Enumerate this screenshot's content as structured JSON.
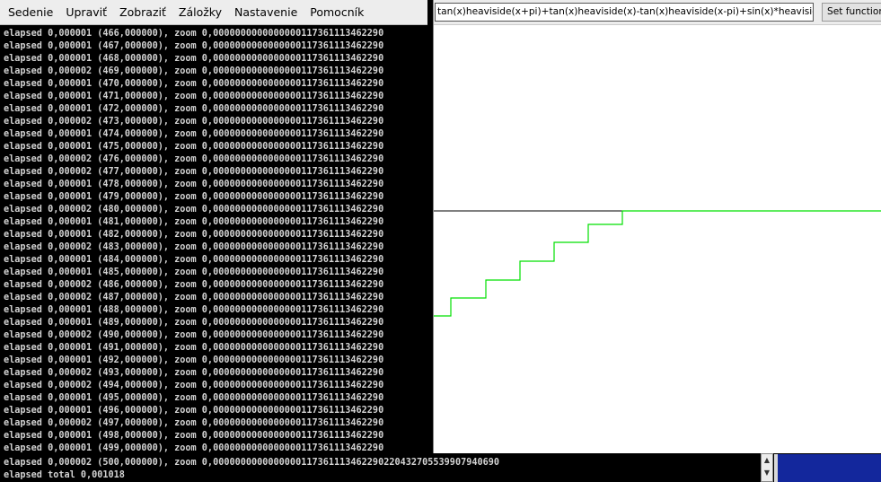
{
  "terminal": {
    "menu": [
      "Sedenie",
      "Upraviť",
      "Zobraziť",
      "Záložky",
      "Nastavenie",
      "Pomocník"
    ],
    "lines": [
      "elapsed 0,000001 (466,000000), zoom 0,0000000000000000117361113462290",
      "elapsed 0,000001 (467,000000), zoom 0,0000000000000000117361113462290",
      "elapsed 0,000001 (468,000000), zoom 0,0000000000000000117361113462290",
      "elapsed 0,000002 (469,000000), zoom 0,0000000000000000117361113462290",
      "elapsed 0,000001 (470,000000), zoom 0,0000000000000000117361113462290",
      "elapsed 0,000001 (471,000000), zoom 0,0000000000000000117361113462290",
      "elapsed 0,000001 (472,000000), zoom 0,0000000000000000117361113462290",
      "elapsed 0,000002 (473,000000), zoom 0,0000000000000000117361113462290",
      "elapsed 0,000001 (474,000000), zoom 0,0000000000000000117361113462290",
      "elapsed 0,000001 (475,000000), zoom 0,0000000000000000117361113462290",
      "elapsed 0,000002 (476,000000), zoom 0,0000000000000000117361113462290",
      "elapsed 0,000002 (477,000000), zoom 0,0000000000000000117361113462290",
      "elapsed 0,000001 (478,000000), zoom 0,0000000000000000117361113462290",
      "elapsed 0,000001 (479,000000), zoom 0,0000000000000000117361113462290",
      "elapsed 0,000002 (480,000000), zoom 0,0000000000000000117361113462290",
      "elapsed 0,000001 (481,000000), zoom 0,0000000000000000117361113462290",
      "elapsed 0,000001 (482,000000), zoom 0,0000000000000000117361113462290",
      "elapsed 0,000002 (483,000000), zoom 0,0000000000000000117361113462290",
      "elapsed 0,000001 (484,000000), zoom 0,0000000000000000117361113462290",
      "elapsed 0,000001 (485,000000), zoom 0,0000000000000000117361113462290",
      "elapsed 0,000002 (486,000000), zoom 0,0000000000000000117361113462290",
      "elapsed 0,000002 (487,000000), zoom 0,0000000000000000117361113462290",
      "elapsed 0,000001 (488,000000), zoom 0,0000000000000000117361113462290",
      "elapsed 0,000001 (489,000000), zoom 0,0000000000000000117361113462290",
      "elapsed 0,000002 (490,000000), zoom 0,0000000000000000117361113462290",
      "elapsed 0,000001 (491,000000), zoom 0,0000000000000000117361113462290",
      "elapsed 0,000001 (492,000000), zoom 0,0000000000000000117361113462290",
      "elapsed 0,000002 (493,000000), zoom 0,0000000000000000117361113462290",
      "elapsed 0,000002 (494,000000), zoom 0,0000000000000000117361113462290",
      "elapsed 0,000001 (495,000000), zoom 0,0000000000000000117361113462290",
      "elapsed 0,000001 (496,000000), zoom 0,0000000000000000117361113462290",
      "elapsed 0,000002 (497,000000), zoom 0,0000000000000000117361113462290",
      "elapsed 0,000001 (498,000000), zoom 0,0000000000000000117361113462290",
      "elapsed 0,000001 (499,000000), zoom 0,0000000000000000117361113462290"
    ],
    "last_line": "elapsed 0,000002 (500,000000), zoom 0,0000000000000000117361113462290220432705539907940690",
    "total_line": "elapsed total 0,001018"
  },
  "plotter": {
    "function_value": "tan(x)heaviside(x+pi)+tan(x)heaviside(x)-tan(x)heaviside(x-pi)+sin(x)*heaviside(x-pi)",
    "set_button_label": "Set function",
    "axis_color": "#000000",
    "curve_color": "#00e000"
  }
}
